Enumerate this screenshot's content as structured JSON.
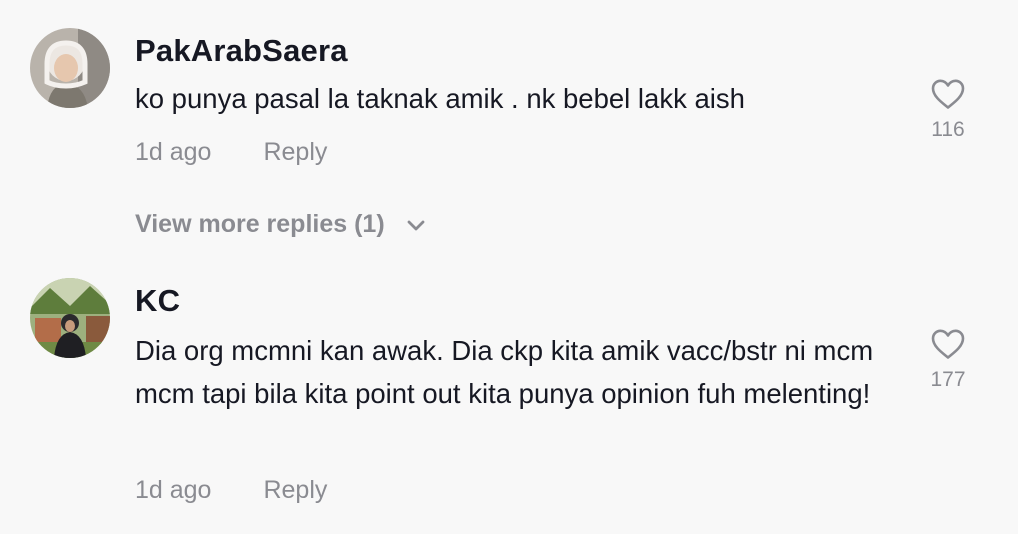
{
  "comments": [
    {
      "username": "PakArabSaera",
      "text": "ko punya pasal la taknak amik . nk bebel lakk aish",
      "time": "1d ago",
      "reply_label": "Reply",
      "like_count": "116"
    },
    {
      "username": "KC",
      "text": "Dia org mcmni kan awak. Dia ckp kita amik vacc/bstr ni mcm mcm tapi bila kita point out kita punya opinion fuh melenting!",
      "time": "1d ago",
      "reply_label": "Reply",
      "like_count": "177"
    }
  ],
  "view_more_replies": "View more replies (1)",
  "icons": {
    "like": "heart-outline-icon",
    "expand": "chevron-down-icon"
  },
  "colors": {
    "background": "#f8f8f8",
    "text_primary": "#161823",
    "text_secondary": "#8a8b91"
  }
}
